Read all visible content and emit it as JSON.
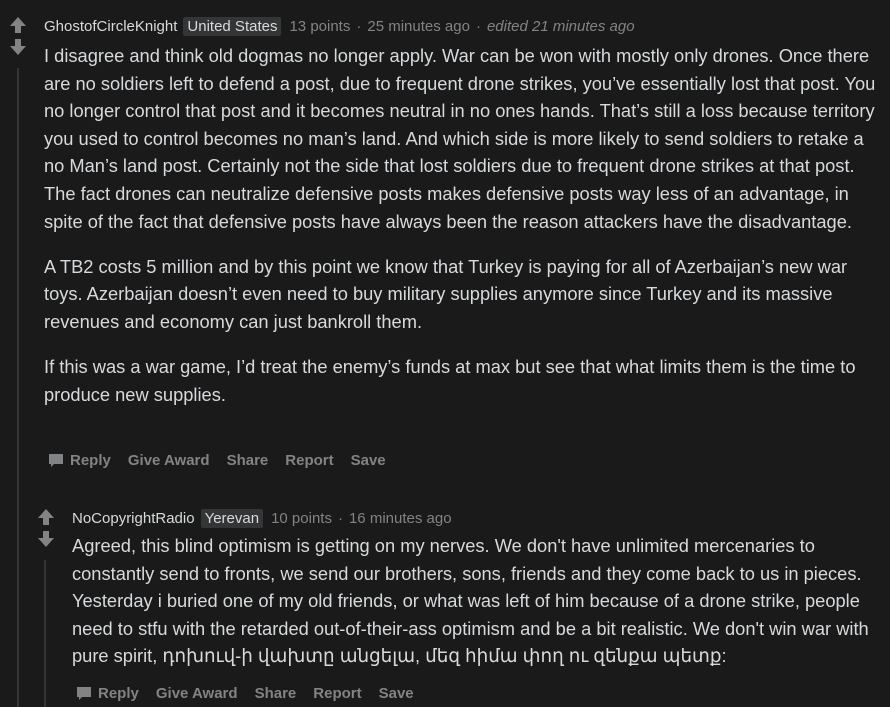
{
  "comments": [
    {
      "author": "GhostofCircleKnight",
      "flair": "United States",
      "points": "13 points",
      "time": "25 minutes ago",
      "edited": "edited 21 minutes ago",
      "paragraphs": [
        "I disagree and think old dogmas no longer apply. War can be won with mostly only drones. Once there are no soldiers left to defend a post, due to frequent drone strikes, you’ve essentially lost that post. You no longer control that post and it becomes neutral in no ones hands. That’s still a loss because territory you used to control becomes no man’s land. And which side is more likely to send soldiers to retake a no Man’s land post. Certainly not the side that lost soldiers due to frequent drone strikes at that post. The fact drones can neutralize defensive posts makes defensive posts way less of an advantage, in spite of the fact that defensive posts have always been the reason attackers have the disadvantage.",
        "A TB2 costs 5 million and by this point we know that Turkey is paying for all of Azerbaijan’s new war toys. Azerbaijan doesn’t even need to buy military supplies anymore since Turkey and its massive revenues and economy can just bankroll them.",
        "If this was a war game, I’d treat the enemy’s funds at max but see that what limits them is the time to produce new supplies."
      ],
      "actions": {
        "reply": "Reply",
        "award": "Give Award",
        "share": "Share",
        "report": "Report",
        "save": "Save"
      }
    },
    {
      "author": "NoCopyrightRadio",
      "flair": "Yerevan",
      "points": "10 points",
      "time": "16 minutes ago",
      "paragraphs": [
        "Agreed, this blind optimism is getting on my nerves. We don't have unlimited mercenaries to constantly send to fronts, we send our brothers, sons, friends and they come back to us in pieces. Yesterday i buried one of my old friends, or what was left of him because of a drone strike, people need to stfu with the retarded out-of-their-ass optimism and be a bit realistic. We don't win war with pure spirit, դոխուվ-ի վախտը անցելա, մեզ հիմա փող ու զենքա պետք:"
      ],
      "actions": {
        "reply": "Reply",
        "award": "Give Award",
        "share": "Share",
        "report": "Report",
        "save": "Save"
      }
    }
  ],
  "icons": [
    "upvote-icon",
    "downvote-icon",
    "chat-bubble-icon"
  ],
  "colors": {
    "background": "#1a1a1b",
    "text": "#d7dadc",
    "muted": "#818384",
    "flair_bg": "#343536"
  }
}
